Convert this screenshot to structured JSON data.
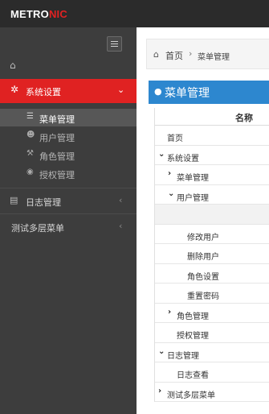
{
  "brand": {
    "prefix": "METRO",
    "accent": "NIC",
    "accent_color": "#e02222"
  },
  "sidebar": {
    "toggle_icon": "menu-toggle-icon",
    "home_icon": "home-icon",
    "active_menu": {
      "icon": "gear-icon",
      "label": "系统设置",
      "arrow": "⌄"
    },
    "submenu": [
      {
        "icon": "list-icon",
        "label": "菜单管理",
        "current": true
      },
      {
        "icon": "users-icon",
        "label": "用户管理",
        "current": false
      },
      {
        "icon": "gavel-icon",
        "label": "角色管理",
        "current": false
      },
      {
        "icon": "eye-icon",
        "label": "授权管理",
        "current": false
      }
    ],
    "menus": [
      {
        "icon": "document-icon",
        "label": "日志管理",
        "arrow": "‹"
      },
      {
        "label": "测试多层菜单",
        "arrow": "‹"
      }
    ]
  },
  "breadcrumb": {
    "home_icon": "home-icon",
    "home": "首页",
    "separator": "›",
    "current": "菜单管理"
  },
  "portlet": {
    "icon": "circle-icon",
    "title": "菜单管理"
  },
  "tree": {
    "header": "名称",
    "rows": [
      {
        "label": "首页",
        "level": 0,
        "toggle": ""
      },
      {
        "label": "系统设置",
        "level": 0,
        "toggle": "down"
      },
      {
        "label": "菜单管理",
        "level": 1,
        "toggle": "right"
      },
      {
        "label": "用户管理",
        "level": 1,
        "toggle": "down"
      },
      {
        "label": "",
        "level": 2,
        "toggle": "",
        "blank": true
      },
      {
        "label": "修改用户",
        "level": 2,
        "toggle": ""
      },
      {
        "label": "删除用户",
        "level": 2,
        "toggle": ""
      },
      {
        "label": "角色设置",
        "level": 2,
        "toggle": ""
      },
      {
        "label": "重置密码",
        "level": 2,
        "toggle": ""
      },
      {
        "label": "角色管理",
        "level": 1,
        "toggle": "right"
      },
      {
        "label": "授权管理",
        "level": 1,
        "toggle": ""
      },
      {
        "label": "日志管理",
        "level": 0,
        "toggle": "down"
      },
      {
        "label": "日志查看",
        "level": 1,
        "toggle": ""
      },
      {
        "label": "测试多层菜单",
        "level": 0,
        "toggle": "right"
      }
    ]
  }
}
